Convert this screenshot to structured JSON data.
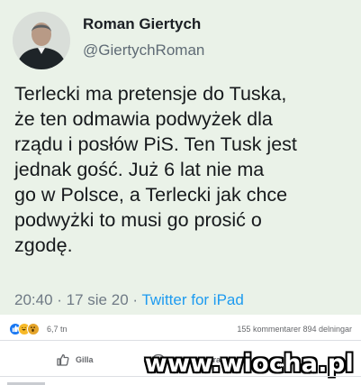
{
  "tweet": {
    "author_name": "Roman Giertych",
    "author_handle": "@GiertychRoman",
    "text_lines": [
      "Terlecki ma pretensje do Tuska,",
      "że ten odmawia podwyżek dla",
      "rządu i posłów PiS. Ten Tusk jest",
      "jednak gość. Już 6 lat nie ma",
      "go w Polsce, a Terlecki jak chce",
      "podwyżki to musi go prosić o",
      "zgodę."
    ],
    "time": "20:40 · 17 sie 20 · ",
    "source": "Twitter for iPad"
  },
  "post": {
    "reaction_icons": [
      "like-icon",
      "laugh-icon",
      "wow-icon"
    ],
    "reaction_colors": [
      "#1877f2",
      "#f7b928",
      "#e4a42a"
    ],
    "reaction_count": "6,7 tn",
    "stats": "155 kommentarer  894 delningar",
    "actions": {
      "like_label": "Gilla",
      "comment_label": "Kommentera"
    }
  },
  "watermark": "www.wiocha.pl"
}
